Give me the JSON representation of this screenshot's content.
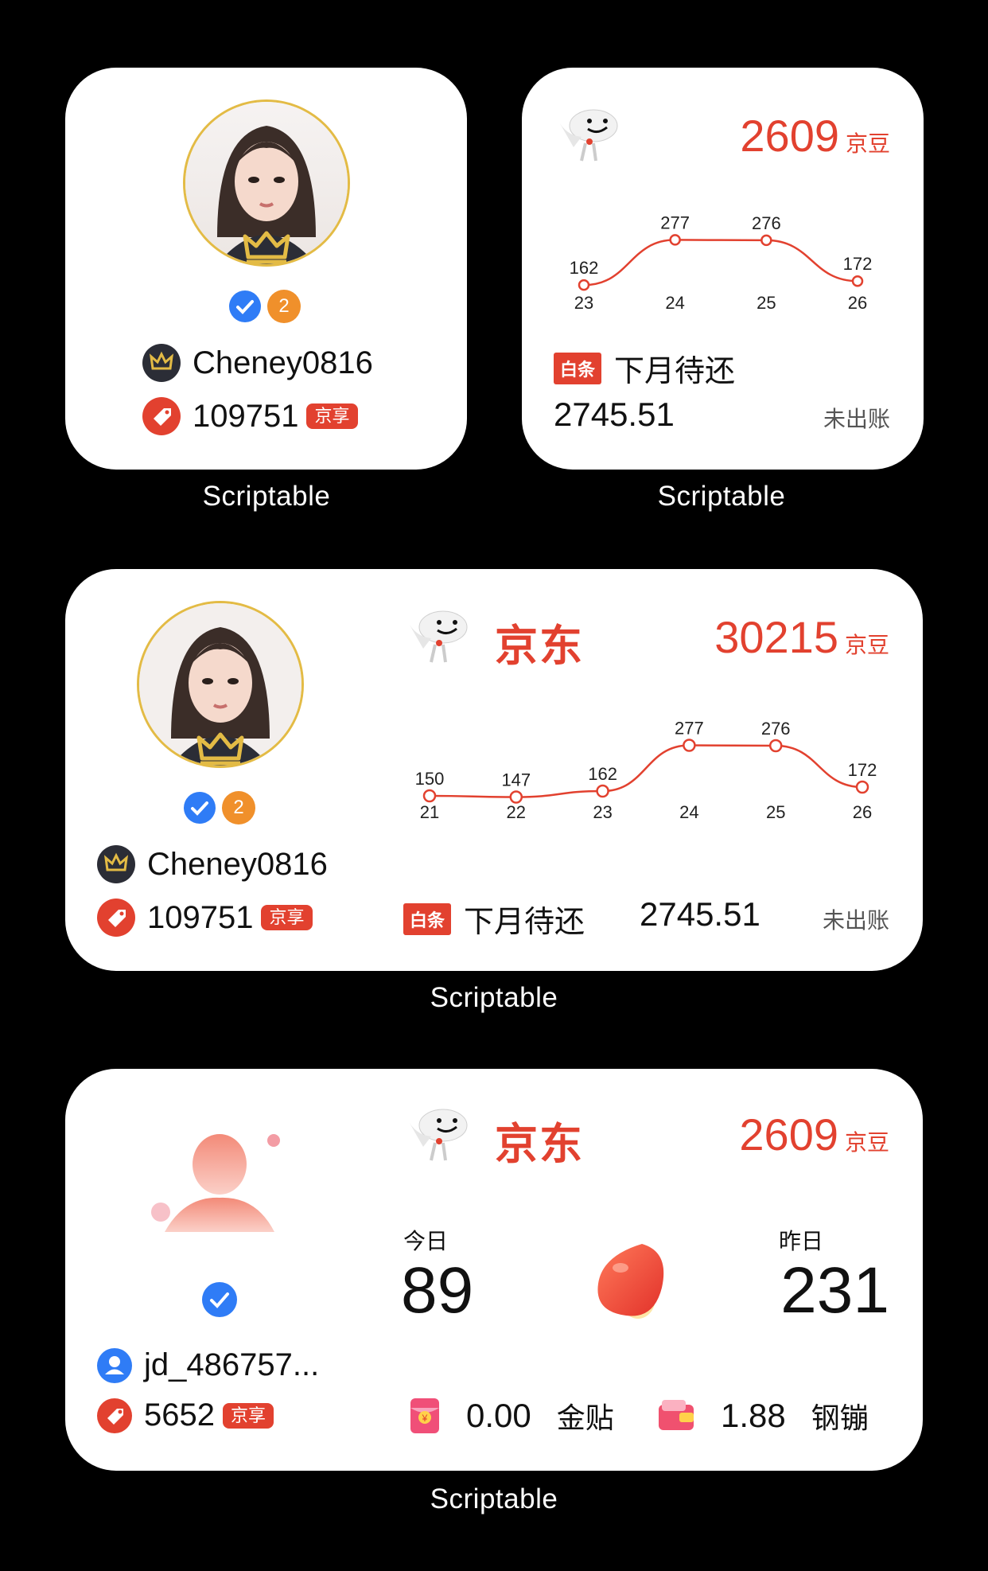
{
  "colors": {
    "accent": "#e2412f",
    "gold": "#e3bb45",
    "dark": "#2b2d36",
    "blue": "#2f7cf6",
    "orange": "#f0902b"
  },
  "widgets": {
    "w1": {
      "verify_level": "2",
      "username": "Cheney0816",
      "beans": "109751",
      "tag": "京享",
      "label": "Scriptable"
    },
    "w2": {
      "beans": "2609",
      "beans_unit": "京豆",
      "baitiao_tag": "白条",
      "due_text": "下月待还",
      "amount": "2745.51",
      "status": "未出账",
      "label": "Scriptable"
    },
    "w3": {
      "verify_level": "2",
      "username": "Cheney0816",
      "beans": "109751",
      "tag": "京享",
      "brand": "京东",
      "total": "30215",
      "total_unit": "京豆",
      "baitiao_tag": "白条",
      "due_text": "下月待还",
      "amount": "2745.51",
      "status": "未出账",
      "label": "Scriptable"
    },
    "w4": {
      "username": "jd_486757...",
      "beans": "5652",
      "tag": "京享",
      "brand": "京东",
      "total": "2609",
      "total_unit": "京豆",
      "today_label": "今日",
      "today_value": "89",
      "yesterday_label": "昨日",
      "yesterday_value": "231",
      "jintie_value": "0.00",
      "jintie_label": "金贴",
      "gangbeng_value": "1.88",
      "gangbeng_label": "钢镚",
      "label": "Scriptable"
    }
  },
  "chart_data": [
    {
      "type": "line",
      "x": [
        "23",
        "24",
        "25",
        "26"
      ],
      "values": [
        162,
        277,
        276,
        172
      ],
      "ylim": [
        140,
        290
      ],
      "grid": false
    },
    {
      "type": "line",
      "x": [
        "21",
        "22",
        "23",
        "24",
        "25",
        "26"
      ],
      "values": [
        150,
        147,
        162,
        277,
        276,
        172
      ],
      "ylim": [
        140,
        290
      ],
      "grid": false
    }
  ]
}
